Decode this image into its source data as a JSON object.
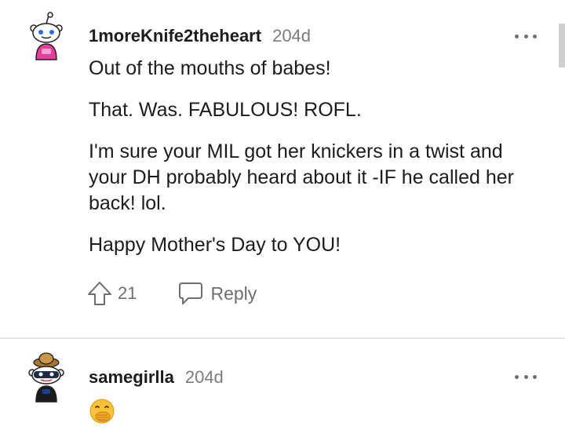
{
  "colors": {
    "text": "#1c1c1c",
    "muted": "#7c7c7c",
    "divider": "#e6e6e6",
    "icon": "#6e6e6e"
  },
  "comments": [
    {
      "username": "1moreKnife2theheart",
      "age": "204d",
      "avatar_icon": "snoo-avatar-pink-icon",
      "paragraphs": [
        "Out of the mouths of babes!",
        "That. Was. FABULOUS! ROFL.",
        "I'm sure your MIL got her knickers in a twist and your DH probably heard about it -IF he called her back! lol.",
        "Happy Mother's Day to YOU!"
      ],
      "votes": "21",
      "reply_label": "Reply"
    },
    {
      "username": "samegirlla",
      "age": "204d",
      "avatar_icon": "snoo-avatar-mask-icon",
      "emoji_icon": "hand-over-mouth-emoji-icon"
    }
  ]
}
